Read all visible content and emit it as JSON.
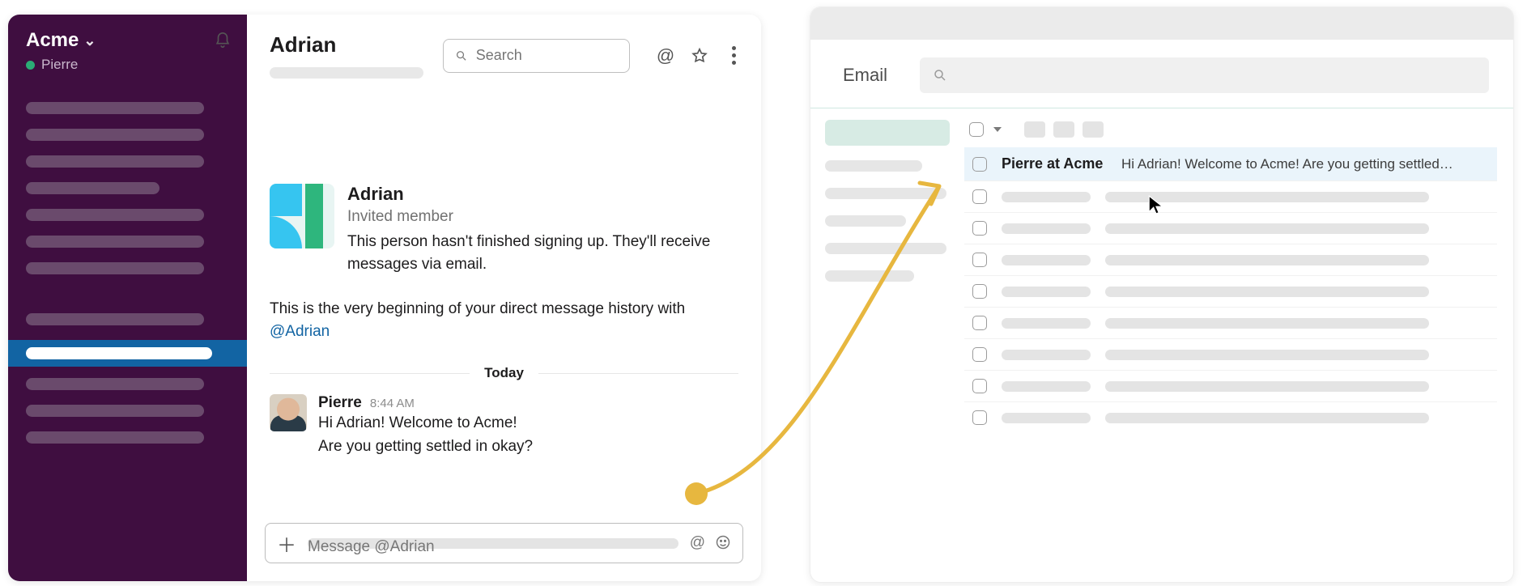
{
  "slack": {
    "workspace": "Acme",
    "user": "Pierre",
    "header": {
      "title": "Adrian",
      "searchPlaceholder": "Search"
    },
    "profile": {
      "name": "Adrian",
      "subtitle": "Invited member",
      "description": "This person hasn't finished signing up. They'll receive messages via email."
    },
    "beginning": {
      "prefix": "This is the very beginning of your direct message history with ",
      "mention": "@Adrian"
    },
    "divider": "Today",
    "message": {
      "author": "Pierre",
      "time": "8:44 AM",
      "line1": "Hi Adrian! Welcome to Acme!",
      "line2": "Are you getting settled in okay?"
    },
    "composer": {
      "placeholder": "Message @Adrian"
    }
  },
  "email": {
    "title": "Email",
    "row": {
      "sender": "Pierre at Acme",
      "preview": "Hi Adrian! Welcome to Acme! Are you getting settled…"
    }
  }
}
